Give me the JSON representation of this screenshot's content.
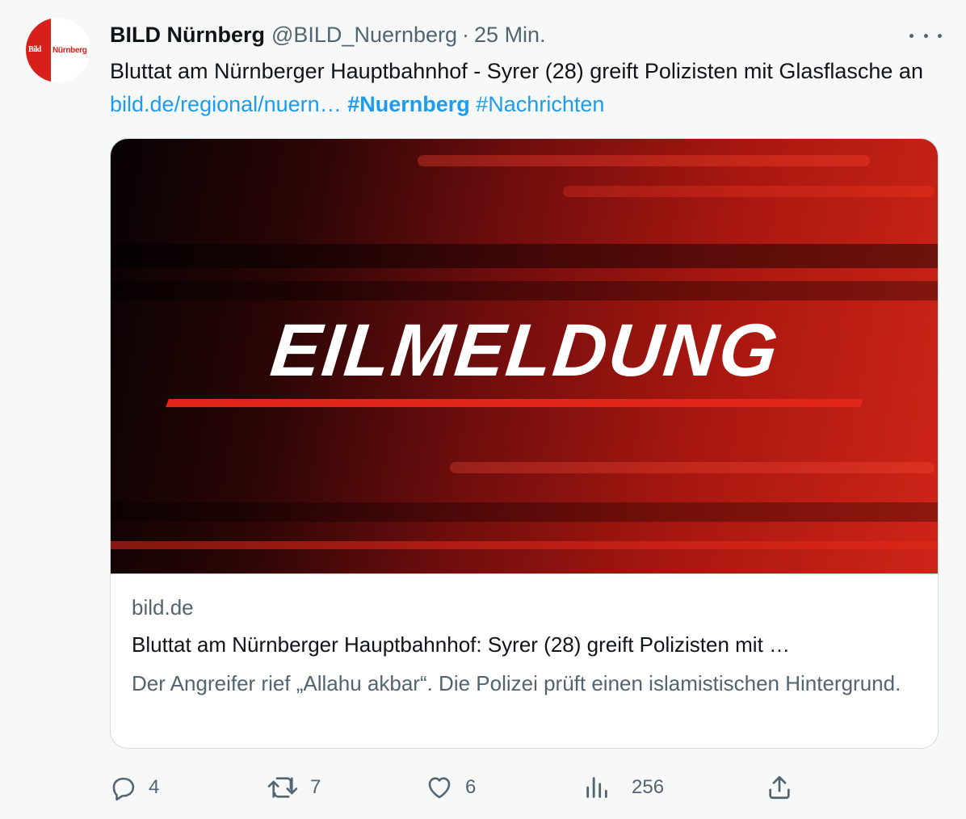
{
  "tweet": {
    "avatar": {
      "brand": "Bild",
      "city": "Nürnberg"
    },
    "author_name": "BILD Nürnberg",
    "handle": "@BILD_Nuernberg",
    "separator": "·",
    "time": "25 Min.",
    "text_part1": "Bluttat am Nürnberger Hauptbahnhof - Syrer (28) greift Polizisten mit Glasflasche an ",
    "link": "bild.de/regional/nuern…",
    "hashtag_primary": "#Nuernberg",
    "hashtag_secondary": "#Nachrichten"
  },
  "card": {
    "image_text": "EILMELDUNG",
    "domain": "bild.de",
    "title": "Bluttat am Nürnberger Hauptbahnhof: Syrer (28) greift Polizisten mit …",
    "description": "Der Angreifer rief „Allahu akbar“. Die Polizei prüft einen islamistischen Hintergrund."
  },
  "actions": {
    "replies": "4",
    "retweets": "7",
    "likes": "6",
    "views": "256"
  },
  "icons": [
    "reply-icon",
    "retweet-icon",
    "like-icon",
    "views-icon",
    "share-icon",
    "more-icon"
  ],
  "colors": {
    "accent": "#1d9bf0",
    "muted": "#536471",
    "text": "#0f1419",
    "background": "#f7f9f9",
    "bild_red": "#d6201a"
  }
}
